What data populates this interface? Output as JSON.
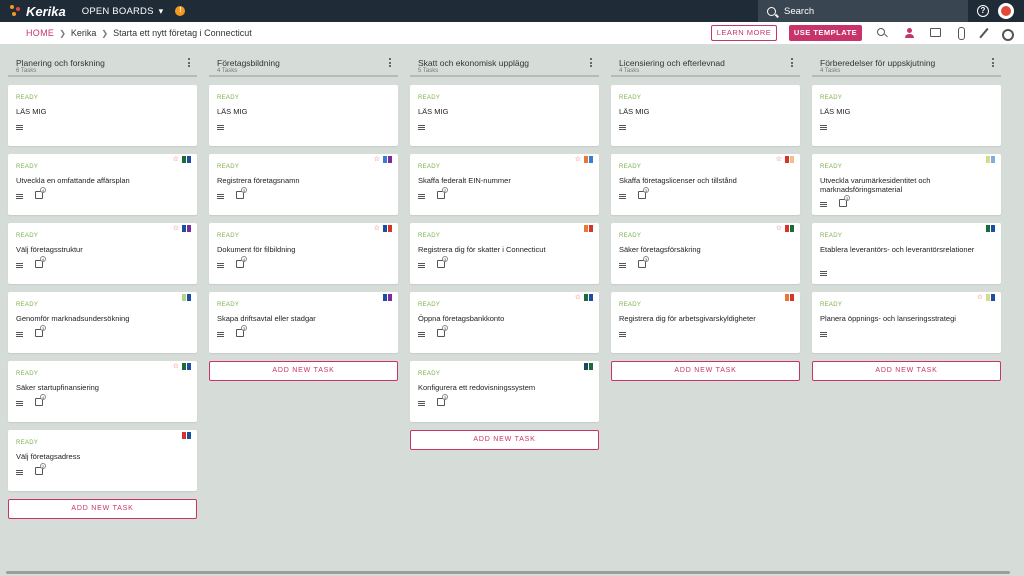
{
  "topbar": {
    "app_name": "Kerika",
    "open_boards_label": "OPEN BOARDS",
    "notification_count": "!",
    "search_placeholder": "Search",
    "help_label": "?"
  },
  "subbar": {
    "breadcrumb": [
      "HOME",
      "Kerika",
      "Starta ett nytt företag i Connecticut"
    ],
    "learn_more_label": "LEARN MORE",
    "use_template_label": "USE TEMPLATE"
  },
  "colors": {
    "accent": "#c8336c",
    "status": "#7db04a",
    "topbar": "#202b38"
  },
  "add_task_label": "ADD NEW TASK",
  "columns": [
    {
      "title": "Planering och forskning",
      "count": "6 Tasks",
      "cards": [
        {
          "status": "READY",
          "title": "LÄS MIG",
          "checklist": "",
          "star": false,
          "flags": []
        },
        {
          "status": "READY",
          "title": "Utveckla en omfattande affärsplan",
          "checklist": "4",
          "star": true,
          "flags": [
            "#1b6a3c",
            "#1d4fa0"
          ]
        },
        {
          "status": "READY",
          "title": "Välj företagsstruktur",
          "checklist": "4",
          "star": true,
          "flags": [
            "#1d4fa0",
            "#7b2aa0"
          ]
        },
        {
          "status": "READY",
          "title": "Genomför marknadsundersökning",
          "checklist": "3",
          "star": false,
          "flags": [
            "#b3d48a",
            "#1d4fa0"
          ]
        },
        {
          "status": "READY",
          "title": "Säker startupfinansiering",
          "checklist": "4",
          "star": true,
          "flags": [
            "#1b6a3c",
            "#1d4fa0"
          ]
        },
        {
          "status": "READY",
          "title": "Välj företagsadress",
          "checklist": "2",
          "star": false,
          "flags": [
            "#d9342c",
            "#1d4fa0"
          ]
        }
      ]
    },
    {
      "title": "Företagsbildning",
      "count": "4 Tasks",
      "cards": [
        {
          "status": "READY",
          "title": "LÄS MIG",
          "checklist": "",
          "star": false,
          "flags": []
        },
        {
          "status": "READY",
          "title": "Registrera företagsnamn",
          "checklist": "3",
          "star": true,
          "flags": [
            "#3a7bd5",
            "#7b2aa0"
          ]
        },
        {
          "status": "READY",
          "title": "Dokument för filbildning",
          "checklist": "4",
          "star": true,
          "flags": [
            "#1d4fa0",
            "#d9342c"
          ]
        },
        {
          "status": "READY",
          "title": "Skapa driftsavtal eller stadgar",
          "checklist": "3",
          "star": false,
          "flags": [
            "#1d4fa0",
            "#7b2aa0"
          ]
        }
      ]
    },
    {
      "title": "Skatt och ekonomisk upplägg",
      "count": "5 Tasks",
      "cards": [
        {
          "status": "READY",
          "title": "LÄS MIG",
          "checklist": "",
          "star": false,
          "flags": []
        },
        {
          "status": "READY",
          "title": "Skaffa federalt EIN-nummer",
          "checklist": "2",
          "star": true,
          "flags": [
            "#e8773a",
            "#3a7bd5"
          ]
        },
        {
          "status": "READY",
          "title": "Registrera dig för skatter i Connecticut",
          "checklist": "3",
          "star": false,
          "flags": [
            "#e8773a",
            "#d9342c"
          ]
        },
        {
          "status": "READY",
          "title": "Öppna företagsbankkonto",
          "checklist": "3",
          "star": true,
          "flags": [
            "#1b6a3c",
            "#1d4fa0"
          ]
        },
        {
          "status": "READY",
          "title": "Konfigurera ett redovisningssystem",
          "checklist": "3",
          "star": false,
          "flags": [
            "#1b4a5c",
            "#1b6a3c"
          ]
        }
      ]
    },
    {
      "title": "Licensiering och efterlevnad",
      "count": "4 Tasks",
      "cards": [
        {
          "status": "READY",
          "title": "LÄS MIG",
          "checklist": "",
          "star": false,
          "flags": []
        },
        {
          "status": "READY",
          "title": "Skaffa företagslicenser och tillstånd",
          "checklist": "3",
          "star": true,
          "flags": [
            "#d9342c",
            "#f0c08a"
          ]
        },
        {
          "status": "READY",
          "title": "Säker företagsförsäkring",
          "checklist": "3",
          "star": true,
          "flags": [
            "#d9342c",
            "#1b6a3c"
          ]
        },
        {
          "status": "READY",
          "title": "Registrera dig för arbetsgivarskyldigheter",
          "checklist": "",
          "star": false,
          "flags": [
            "#e8773a",
            "#d9342c"
          ]
        }
      ]
    },
    {
      "title": "Förberedelser för uppskjutning",
      "count": "4 Tasks",
      "cards": [
        {
          "status": "READY",
          "title": "LÄS MIG",
          "checklist": "",
          "star": false,
          "flags": []
        },
        {
          "status": "READY",
          "title": "Utveckla varumärkesidentitet och marknadsföringsmaterial",
          "checklist": "3",
          "star": false,
          "flags": [
            "#d6dd8a",
            "#7ab0e0"
          ]
        },
        {
          "status": "READY",
          "title": "Etablera leverantörs- och leverantörsrelationer",
          "checklist": "",
          "star": false,
          "flags": [
            "#1b6a3c",
            "#1d4fa0"
          ]
        },
        {
          "status": "READY",
          "title": "Planera öppnings- och lanseringsstrategi",
          "checklist": "",
          "star": true,
          "flags": [
            "#d6dd8a",
            "#1d4fa0"
          ]
        }
      ]
    }
  ]
}
